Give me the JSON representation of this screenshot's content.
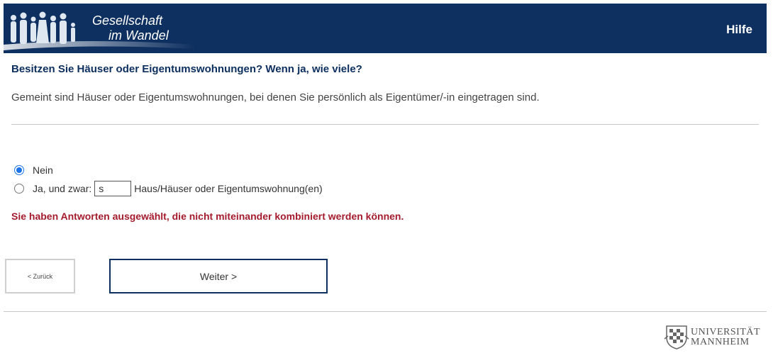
{
  "header": {
    "logo_line1": "Gesellschaft",
    "logo_line2": "im Wandel",
    "help_label": "Hilfe"
  },
  "question": {
    "title": "Besitzen Sie Häuser oder Eigentumswohnungen? Wenn ja, wie viele?",
    "instruction": "Gemeint sind Häuser oder Eigentumswohnungen, bei denen Sie persönlich als Eigentümer/-in eingetragen sind."
  },
  "options": [
    {
      "label": "Nein",
      "checked": true
    },
    {
      "label": "Ja, und zwar:",
      "input_value": "s",
      "suffix": "Haus/Häuser oder Eigentumswohnung(en)",
      "checked": false
    }
  ],
  "error_message": "Sie haben Antworten ausgewählt, die nicht miteinander kombiniert werden können.",
  "nav": {
    "back_label": "< Zurück",
    "next_label": "Weiter >"
  },
  "footer": {
    "university_line1": "UNIVERSITÄT",
    "university_line2": "MANNHEIM"
  },
  "colors": {
    "header_bg": "#0e3060",
    "error": "#a31b2d",
    "radio_selected": "#1a73e8"
  },
  "icons": {
    "logo": "silhouettes-people-icon",
    "university": "university-seal-icon"
  }
}
